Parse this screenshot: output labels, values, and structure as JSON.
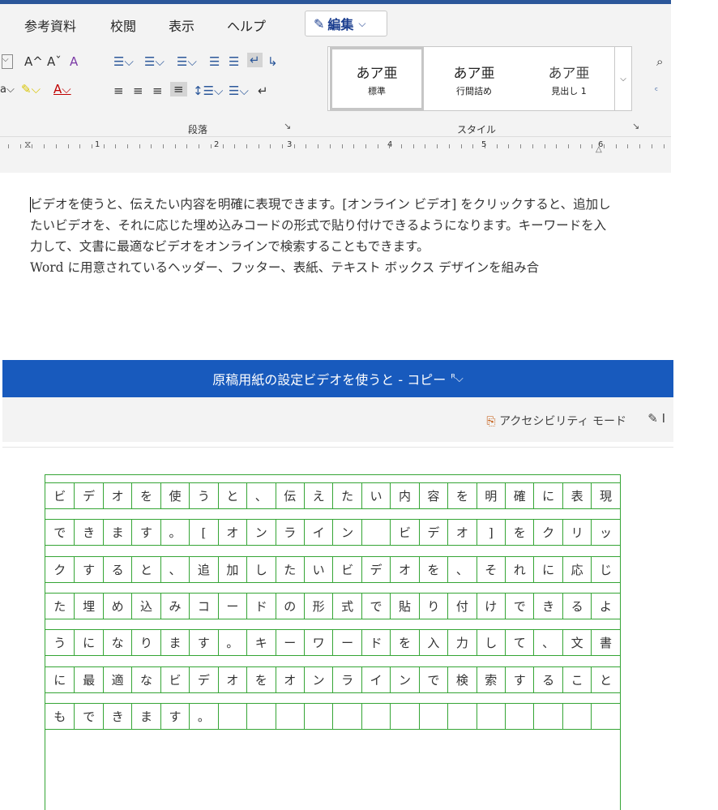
{
  "ribbon": {
    "tabs": [
      "参考資料",
      "校閲",
      "表示",
      "ヘルプ"
    ],
    "edit_mode_label": "編集",
    "font_buttons": {
      "grow": "A^",
      "shrink": "Aˇ",
      "clear": "A"
    },
    "paragraph_group_label": "段落",
    "styles_group_label": "スタイル",
    "styles": [
      {
        "sample": "あア亜",
        "name": "標準"
      },
      {
        "sample": "あア亜",
        "name": "行間詰め"
      },
      {
        "sample": "あア亜",
        "name": "見出し 1"
      }
    ],
    "ruler_numbers": [
      "1",
      "2",
      "3",
      "4",
      "5",
      "6"
    ]
  },
  "document1": {
    "text": "ビデオを使うと、伝えたい内容を明確に表現できます。[オンライン ビデオ] をクリックすると、追加したいビデオを、それに応じた埋め込みコードの形式で貼り付けできるようになります。キーワードを入力して、文書に最適なビデオをオンラインで検索することもできます。",
    "next_line": "Word に用意されているヘッダー、フッター、表紙、テキスト ボックス デザインを組み合"
  },
  "window2": {
    "title": "原稿用紙の設定ビデオを使うと - コピー",
    "accessibility_mode": "アクセシビリティ モード"
  },
  "genkou": {
    "rows": [
      [
        "ビ",
        "デ",
        "オ",
        "を",
        "使",
        "う",
        "と",
        "、",
        "伝",
        "え",
        "た",
        "い",
        "内",
        "容",
        "を",
        "明",
        "確",
        "に",
        "表",
        "現"
      ],
      [
        "で",
        "き",
        "ま",
        "す",
        "。",
        "[",
        "オ",
        "ン",
        "ラ",
        "イ",
        "ン",
        "",
        "ビ",
        "デ",
        "オ",
        "]",
        "を",
        "ク",
        "リ",
        "ッ"
      ],
      [
        "ク",
        "す",
        "る",
        "と",
        "、",
        "追",
        "加",
        "し",
        "た",
        "い",
        "ビ",
        "デ",
        "オ",
        "を",
        "、",
        "そ",
        "れ",
        "に",
        "応",
        "じ"
      ],
      [
        "た",
        "埋",
        "め",
        "込",
        "み",
        "コ",
        "ー",
        "ド",
        "の",
        "形",
        "式",
        "で",
        "貼",
        "り",
        "付",
        "け",
        "で",
        "き",
        "る",
        "よ"
      ],
      [
        "う",
        "に",
        "な",
        "り",
        "ま",
        "す",
        "。",
        "キ",
        "ー",
        "ワ",
        "ー",
        "ド",
        "を",
        "入",
        "力",
        "し",
        "て",
        "、",
        "文",
        "書"
      ],
      [
        "に",
        "最",
        "適",
        "な",
        "ビ",
        "デ",
        "オ",
        "を",
        "オ",
        "ン",
        "ラ",
        "イ",
        "ン",
        "で",
        "検",
        "索",
        "す",
        "る",
        "こ",
        "と"
      ],
      [
        "も",
        "で",
        "き",
        "ま",
        "す",
        "。",
        "",
        "",
        "",
        "",
        "",
        "",
        "",
        "",
        "",
        "",
        "",
        "",
        "",
        ""
      ]
    ]
  }
}
